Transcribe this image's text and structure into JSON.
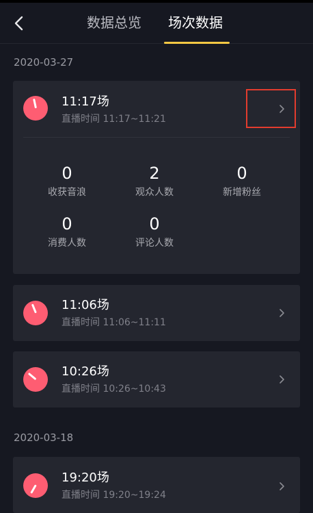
{
  "header": {
    "tabs": [
      {
        "label": "数据总览",
        "active": false
      },
      {
        "label": "场次数据",
        "active": true
      }
    ],
    "accent_color": "#f6c844"
  },
  "sections": [
    {
      "date": "2020-03-27",
      "sessions": [
        {
          "title": "11:17场",
          "subtitle": "直播时间 11:17~11:21",
          "expanded": true,
          "stats": [
            {
              "value": "0",
              "label": "收获音浪"
            },
            {
              "value": "2",
              "label": "观众人数"
            },
            {
              "value": "0",
              "label": "新增粉丝"
            },
            {
              "value": "0",
              "label": "消费人数"
            },
            {
              "value": "0",
              "label": "评论人数"
            }
          ]
        },
        {
          "title": "11:06场",
          "subtitle": "直播时间 11:06~11:11",
          "expanded": false
        },
        {
          "title": "10:26场",
          "subtitle": "直播时间 10:26~10:43",
          "expanded": false
        }
      ]
    },
    {
      "date": "2020-03-18",
      "sessions": [
        {
          "title": "19:20场",
          "subtitle": "直播时间 19:20~19:24",
          "expanded": false
        }
      ]
    }
  ],
  "icons": {
    "back": "chevron-left-icon",
    "row_arrow": "chevron-right-icon",
    "session": "clock-avatar-icon"
  },
  "colors": {
    "background": "#161821",
    "card": "#24262f",
    "avatar": "#fe5d72",
    "highlight_box": "#e33c2e"
  }
}
